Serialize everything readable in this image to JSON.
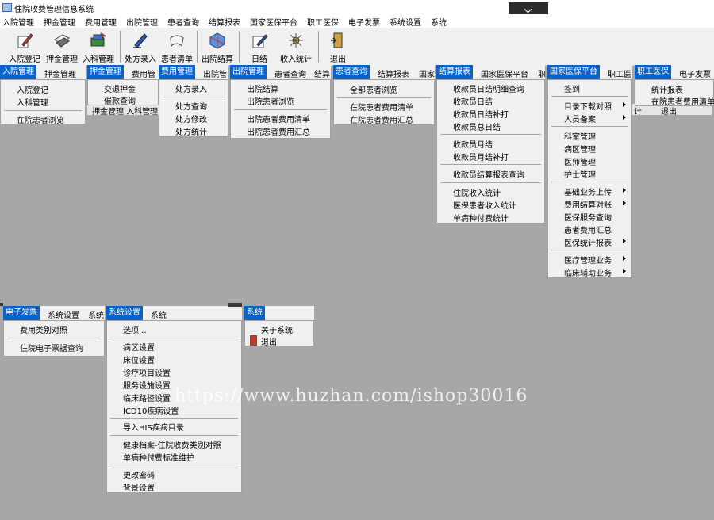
{
  "window": {
    "title": "住院收费管理信息系统"
  },
  "menubar": [
    "入院管理",
    "押金管理",
    "费用管理",
    "出院管理",
    "患者查询",
    "结算报表",
    "国家医保平台",
    "职工医保",
    "电子发票",
    "系统设置",
    "系统"
  ],
  "toolbar": [
    "入院登记",
    "押金管理",
    "入科管理",
    "处方录入",
    "患者清单",
    "出院结算",
    "日结",
    "收入统计",
    "退出"
  ],
  "peek": {
    "menu_row": "押金管理  入科管理",
    "cell_a": "计",
    "cell_b": "退出"
  },
  "bars": {
    "b1": [
      "入院管理",
      "押金管理"
    ],
    "b2": [
      "押金管理",
      "费用管"
    ],
    "b3": [
      "费用管理",
      "出院管"
    ],
    "b4": [
      "出院管理",
      "患者查询",
      "结算"
    ],
    "b5": [
      "患者查询",
      "结算报表",
      "国家"
    ],
    "b6": [
      "结算报表",
      "国家医保平台",
      "职"
    ],
    "b7": [
      "国家医保平台",
      "职工医"
    ],
    "b8": [
      "职工医保",
      "电子发票"
    ],
    "b9": [
      "电子发票",
      "系统设置",
      "系统"
    ],
    "b10": [
      "系统设置",
      "系统"
    ],
    "b11": [
      "系统"
    ]
  },
  "menus": {
    "ruyuan": [
      "入院登记",
      "入科管理",
      "在院患者浏览"
    ],
    "yajin": [
      "交退押金",
      "催款查询"
    ],
    "feiyong": [
      "处方录入",
      "处方查询",
      "处方修改",
      "处方统计"
    ],
    "chuyuan": [
      "出院结算",
      "出院患者浏览",
      "出院患者费用清单",
      "出院患者费用汇总"
    ],
    "huanzhe": [
      "全部患者浏览",
      "在院患者费用清单",
      "在院患者费用汇总"
    ],
    "jiesuan": [
      "收款员日结明细查询",
      "收款员日结",
      "收款员日结补打",
      "收款员总日结",
      "收款员月结",
      "收款员月结补打",
      "收款员结算报表查询",
      "住院收入统计",
      "医保患者收入统计",
      "单病种付费统计"
    ],
    "yibao": [
      "签到",
      "目录下载对照",
      "人员备案",
      "科室管理",
      "病区管理",
      "医师管理",
      "护士管理",
      "基础业务上传",
      "费用结算对账",
      "医保服务查询",
      "患者费用汇总",
      "医保统计报表",
      "医疗管理业务",
      "临床辅助业务"
    ],
    "zhigong": [
      "统计报表",
      "在院患者费用清单"
    ],
    "fapiao": [
      "费用类别对照",
      "住院电子票据查询"
    ],
    "shezhi": [
      "选项...",
      "病区设置",
      "床位设置",
      "诊疗项目设置",
      "服务设施设置",
      "临床路径设置",
      "ICD10疾病设置",
      "导入HIS疾病目录",
      "健康档案-住院收费类别对照",
      "单病种付费标准维护",
      "更改密码",
      "背景设置"
    ],
    "xitong": [
      "关于系统",
      "退出"
    ]
  },
  "watermark": "https://www.huzhan.com/ishop30016",
  "colors": {
    "highlight": "#0a64c8",
    "menu_bg": "#f0f0f0",
    "desktop": "#a7a7a7"
  }
}
